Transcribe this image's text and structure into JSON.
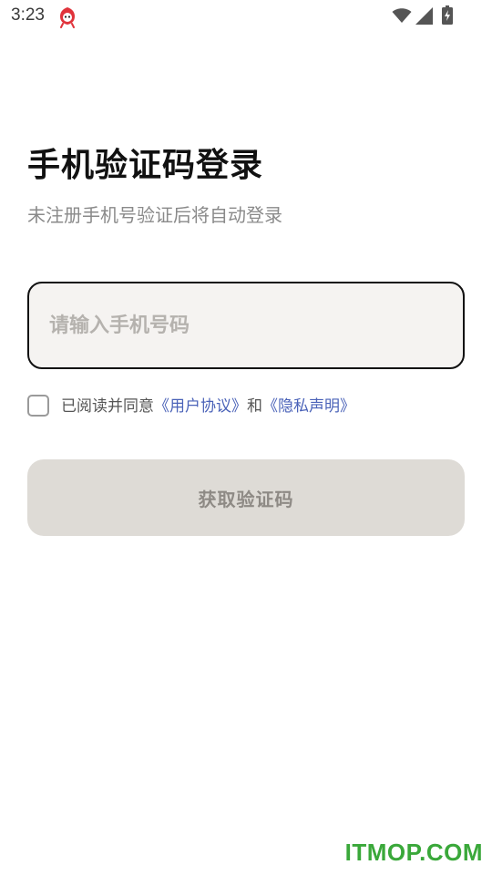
{
  "status_bar": {
    "time": "3:23",
    "icons": [
      "app-notification-icon",
      "wifi-icon",
      "signal-icon",
      "battery-charging-icon"
    ]
  },
  "login": {
    "title": "手机验证码登录",
    "subtitle": "未注册手机号验证后将自动登录",
    "phone_placeholder": "请输入手机号码",
    "phone_value": "",
    "agreement_checked": false,
    "agreement_prefix": "已阅读并同意",
    "user_agreement_link": "《用户协议》",
    "agreement_and": "和",
    "privacy_link": "《隐私声明》",
    "submit_label": "获取验证码"
  },
  "watermark": "ITMOP.COM",
  "colors": {
    "link": "#4a62b8",
    "input_bg": "#f5f3f1",
    "button_disabled_bg": "#dedbd6",
    "watermark": "#3aa83a"
  }
}
